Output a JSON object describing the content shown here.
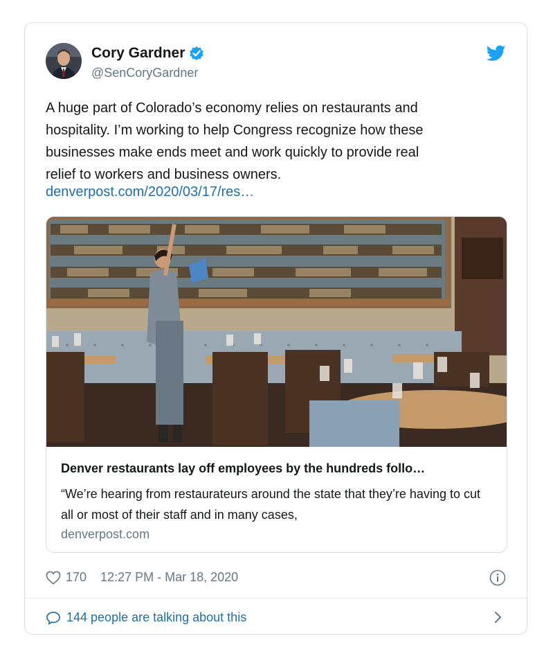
{
  "tweet": {
    "author_name": "Cory Gardner",
    "author_handle": "@SenCoryGardner",
    "text": "A huge part of Colorado’s economy relies on restaurants and\nhospitality. I’m working to help Congress recognize how these\nbusinesses make ends meet and work quickly to provide real\nrelief to workers and business owners.",
    "link_text": "denverpost.com/2020/03/17/res…",
    "likes": "170",
    "timestamp": "12:27 PM - Mar 18, 2020",
    "talking_text": "144 people are talking about this"
  },
  "link_card": {
    "title": "Denver restaurants lay off employees by the hundreds follo…",
    "description": "“We’re hearing from restaurateurs around the state that they’re having to cut all or most of their staff and in many cases,",
    "domain": "denverpost.com"
  },
  "colors": {
    "link": "#1b6faa",
    "twitter_blue": "#1da1f2",
    "muted_text": "#657786",
    "border": "#d9dee3"
  },
  "icons": [
    "verified-badge-icon",
    "twitter-bird-icon",
    "heart-icon",
    "info-icon",
    "speech-bubble-icon",
    "chevron-right-icon"
  ]
}
